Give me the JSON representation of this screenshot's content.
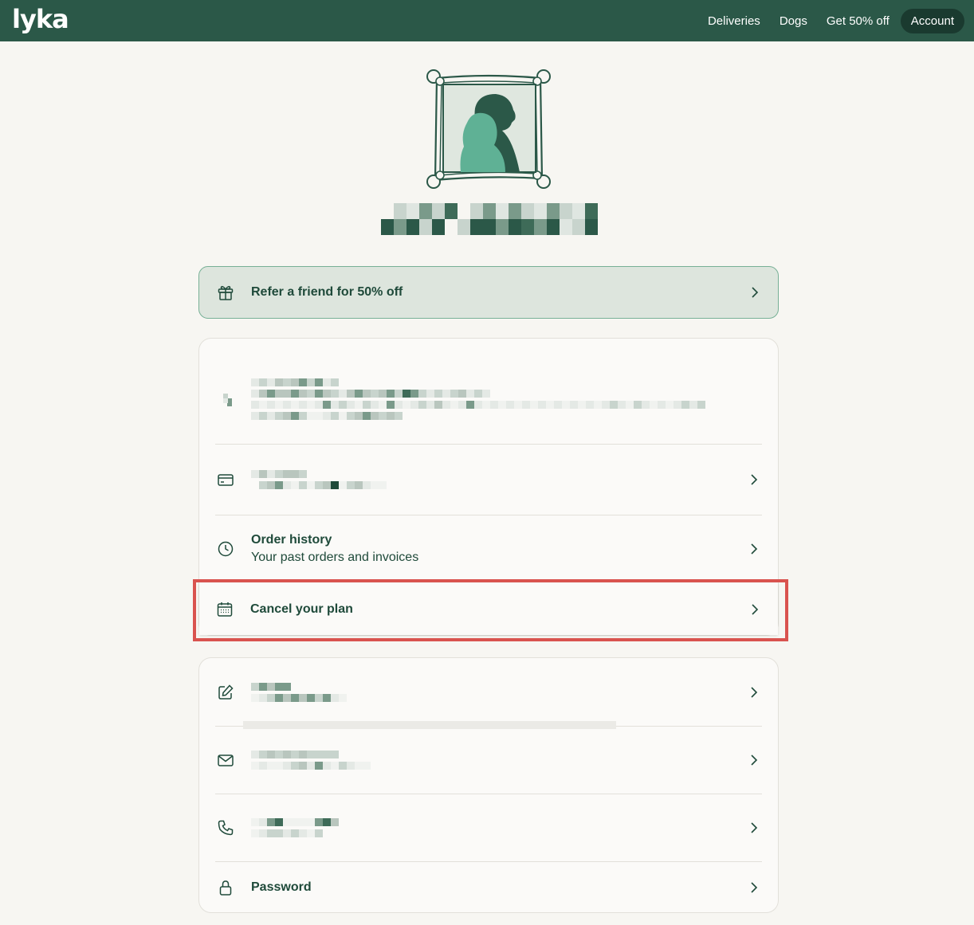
{
  "header": {
    "logo": "lyka",
    "nav": [
      {
        "label": "Deliveries"
      },
      {
        "label": "Dogs"
      },
      {
        "label": "Get 50% off"
      },
      {
        "label": "Account"
      }
    ]
  },
  "referral": {
    "label": "Refer a friend for 50% off",
    "icon": "gift-icon"
  },
  "plan_section": {
    "order_history": {
      "title": "Order history",
      "subtitle": "Your past orders and invoices",
      "icon": "clock-icon"
    },
    "cancel_plan": {
      "title": "Cancel your plan",
      "icon": "calendar-icon"
    },
    "payment": {
      "icon": "credit-card-icon"
    }
  },
  "details_section": {
    "name": {
      "icon": "edit-icon"
    },
    "email": {
      "icon": "mail-icon"
    },
    "phone": {
      "icon": "phone-icon"
    },
    "password": {
      "title": "Password",
      "icon": "lock-icon"
    }
  },
  "colors": {
    "header_bg": "#2b5848",
    "accent": "#1f4a3a",
    "referral_bg": "#dde5dd",
    "highlight": "#d9534f"
  }
}
